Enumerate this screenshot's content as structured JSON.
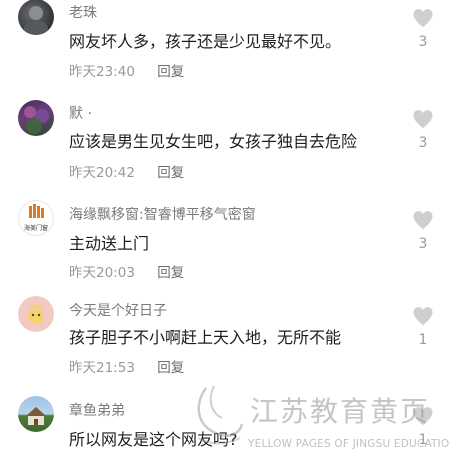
{
  "comments": [
    {
      "user": "老珠",
      "text": "网友坏人多，孩子还是少见最好不见。",
      "time": "昨天23:40",
      "reply": "回复",
      "likes": "3"
    },
    {
      "user": "默 ·",
      "text": "应该是男生见女生吧，女孩子独自去危险",
      "time": "昨天20:42",
      "reply": "回复",
      "likes": "3"
    },
    {
      "user": "海缘飘移窗:智睿博平移气密窗",
      "avatar_text": "海美门窗",
      "text": "主动送上门",
      "time": "昨天20:03",
      "reply": "回复",
      "likes": "3"
    },
    {
      "user": "今天是个好日子",
      "text": "孩子胆子不小啊赶上天入地，无所不能",
      "time": "昨天21:53",
      "reply": "回复",
      "likes": "1"
    },
    {
      "user": "章鱼弟弟",
      "text": "所以网友是这个网友吗?",
      "likes": "1"
    }
  ],
  "watermark": {
    "title": "江苏教育黄页",
    "subtitle": "YELLOW PAGES OF JINGSU EDUCATIONS"
  },
  "colors": {
    "username": "#7a7a7a",
    "text": "#1e1e1e",
    "meta": "#9a9a9a",
    "heart": "#cfcfcf"
  },
  "icons": [
    "heart-icon"
  ]
}
